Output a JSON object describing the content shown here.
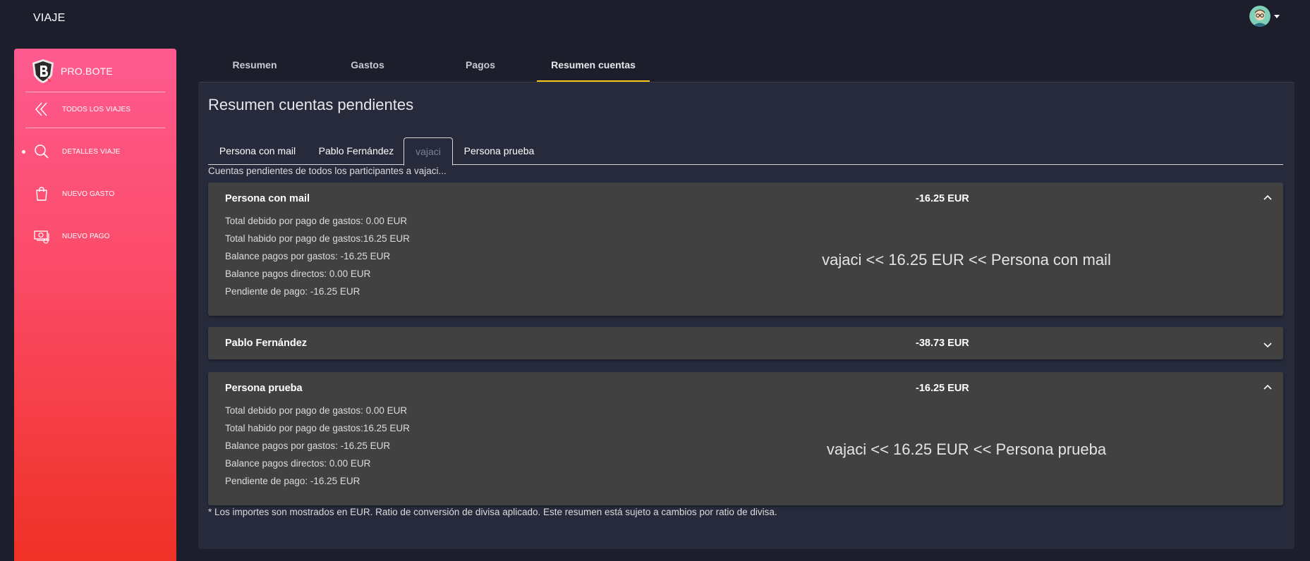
{
  "app": {
    "title": "VIAJE"
  },
  "sidebar": {
    "brand": "PRO.BOTE",
    "items": [
      {
        "label": "TODOS LOS VIAJES",
        "icon": "double-chevron-left-icon"
      },
      {
        "label": "DETALLES VIAJE",
        "icon": "search-icon",
        "active": true
      },
      {
        "label": "NUEVO GASTO",
        "icon": "shopping-bag-icon"
      },
      {
        "label": "NUEVO PAGO",
        "icon": "money-icon"
      }
    ]
  },
  "main_tabs": [
    {
      "label": "Resumen"
    },
    {
      "label": "Gastos"
    },
    {
      "label": "Pagos"
    },
    {
      "label": "Resumen cuentas",
      "active": true
    }
  ],
  "panel": {
    "title": "Resumen cuentas pendientes",
    "subtabs": [
      {
        "label": "Persona con mail"
      },
      {
        "label": "Pablo Fernández"
      },
      {
        "label": "vajaci",
        "active": true
      },
      {
        "label": "Persona prueba"
      }
    ],
    "subtitle": "Cuentas pendientes de todos los participantes a vajaci...",
    "cards": [
      {
        "name": "Persona con mail",
        "amount": "-16.25 EUR",
        "expanded": true,
        "lines": [
          "Total debido por pago de gastos: 0.00 EUR",
          "Total habido por pago de gastos:16.25 EUR",
          "Balance pagos por gastos: -16.25 EUR",
          "Balance pagos directos: 0.00 EUR",
          "Pendiente de pago: -16.25 EUR"
        ],
        "flow": "vajaci << 16.25 EUR << Persona con mail"
      },
      {
        "name": "Pablo Fernández",
        "amount": "-38.73 EUR",
        "expanded": false
      },
      {
        "name": "Persona prueba",
        "amount": "-16.25 EUR",
        "expanded": true,
        "lines": [
          "Total debido por pago de gastos: 0.00 EUR",
          "Total habido por pago de gastos:16.25 EUR",
          "Balance pagos por gastos: -16.25 EUR",
          "Balance pagos directos: 0.00 EUR",
          "Pendiente de pago: -16.25 EUR"
        ],
        "flow": "vajaci << 16.25 EUR << Persona prueba"
      }
    ],
    "footnote": "* Los importes son mostrados en EUR. Ratio de conversión de divisa aplicado. Este resumen está sujeto a cambios por ratio de divisa."
  },
  "colors": {
    "background": "#1d1e2c",
    "panel": "#262a3b",
    "card": "#414141",
    "tab_indicator": "#f5c518",
    "sidebar_top": "#ff5b91",
    "sidebar_bottom": "#ef3127"
  }
}
